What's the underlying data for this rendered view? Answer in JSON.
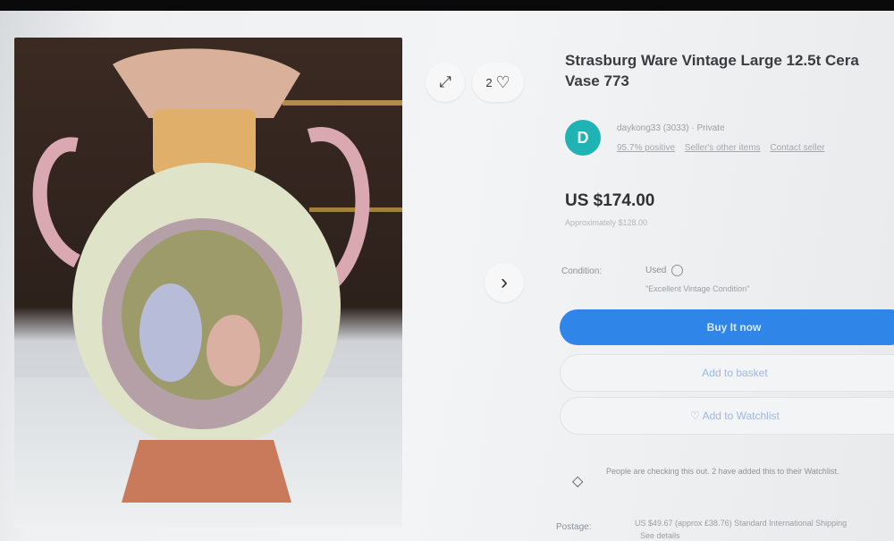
{
  "listing": {
    "title_line1": "Strasburg Ware Vintage Large 12.5t Cera",
    "title_line2": "Vase 773",
    "watch_count": "2",
    "next_arrow": "›"
  },
  "seller": {
    "avatar_letter": "D",
    "name_line": "daykong33 (3033) · Private",
    "feedback": "95.7% positive",
    "other_items": "Seller's other items",
    "contact": "Contact seller"
  },
  "pricing": {
    "price": "US $174.00",
    "approx": "Approximately $128.00"
  },
  "condition": {
    "label": "Condition:",
    "value": "Used",
    "note": "\"Excellent Vintage Condition\""
  },
  "actions": {
    "buy_now": "Buy It now",
    "add_to_basket": "Add to basket",
    "add_to_watchlist": "♡ Add to Watchlist"
  },
  "promo": {
    "text": "People are checking this out. 2 have added this to their Watchlist."
  },
  "postage": {
    "label": "Postage:",
    "text": "US $49.67 (approx £38.76) Standard International Shipping",
    "sub": "See details"
  },
  "icons": {
    "expand": "expand-icon",
    "heart": "heart-icon",
    "next": "chevron-right-icon",
    "info": "info-icon",
    "promo": "diamond-icon"
  },
  "colors": {
    "buy_button": "#2f86e8",
    "avatar": "#1fb3b3"
  }
}
